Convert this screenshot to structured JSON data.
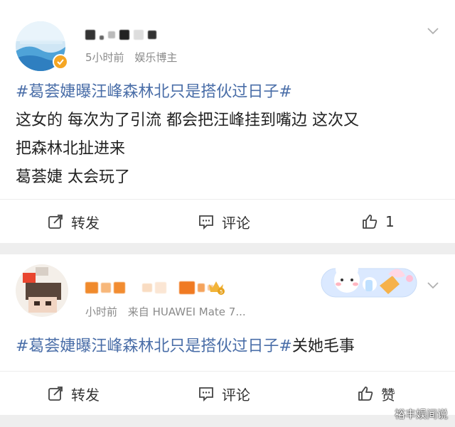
{
  "posts": [
    {
      "meta": {
        "time": "5小时前",
        "tag": "娱乐博主"
      },
      "content": {
        "hashtag": "#葛荟婕曝汪峰森林北只是搭伙过日子#",
        "lines": [
          "这女的  每次为了引流  都会把汪峰挂到嘴边  这次又",
          "把森林北扯进来",
          "葛荟婕  太会玩了"
        ]
      },
      "actions": {
        "repost": "转发",
        "comment": "评论",
        "like": "1"
      }
    },
    {
      "meta": {
        "time": "小时前",
        "source": "来自 HUAWEI Mate 7..."
      },
      "content": {
        "hashtag": "#葛荟婕曝汪峰森林北只是搭伙过日子#",
        "tail": "关她毛事"
      },
      "actions": {
        "repost": "转发",
        "comment": "评论",
        "like": "赞"
      }
    }
  ],
  "watermark": "裕丰娱间说",
  "colors": {
    "hashtag": "#4a6ea8",
    "meta": "#8a8a8a",
    "separator": "#eeeeee"
  },
  "icons": [
    "verified-badge-icon",
    "chevron-down-icon",
    "repost-icon",
    "comment-icon",
    "like-icon",
    "crown-badge-icon",
    "sticker-card-icon"
  ]
}
